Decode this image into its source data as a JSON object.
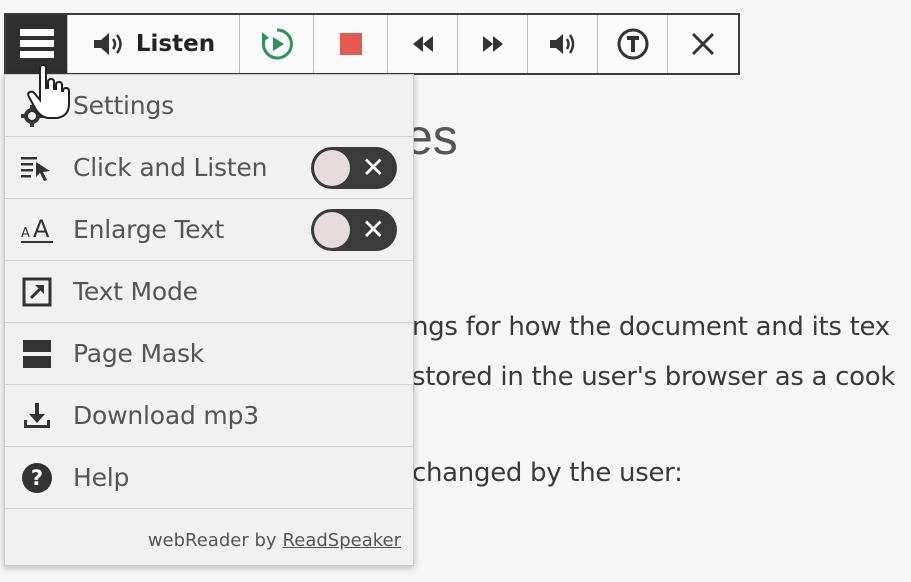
{
  "toolbar": {
    "listen_label": "Listen"
  },
  "menu": {
    "items": [
      {
        "label": "Settings",
        "icon": "gear-icon"
      },
      {
        "label": "Click and Listen",
        "icon": "click-listen-icon",
        "toggle_on": false
      },
      {
        "label": "Enlarge Text",
        "icon": "enlarge-text-icon",
        "toggle_on": false
      },
      {
        "label": "Text Mode",
        "icon": "text-mode-icon"
      },
      {
        "label": "Page Mask",
        "icon": "page-mask-icon"
      },
      {
        "label": "Download mp3",
        "icon": "download-icon"
      },
      {
        "label": "Help",
        "icon": "help-icon"
      }
    ],
    "footer_text": "webReader by",
    "footer_link": "ReadSpeaker"
  },
  "page": {
    "heading_fragment": "es",
    "lines": [
      "ngs for how the document and its tex",
      "stored in the user's browser as a cook",
      "changed by the user:"
    ]
  },
  "colors": {
    "toolbar_border": "#3c3c3c",
    "stop_red": "#e05a4e",
    "play_green": "#2f8f5b",
    "toggle_bg": "#3a3a3a"
  }
}
